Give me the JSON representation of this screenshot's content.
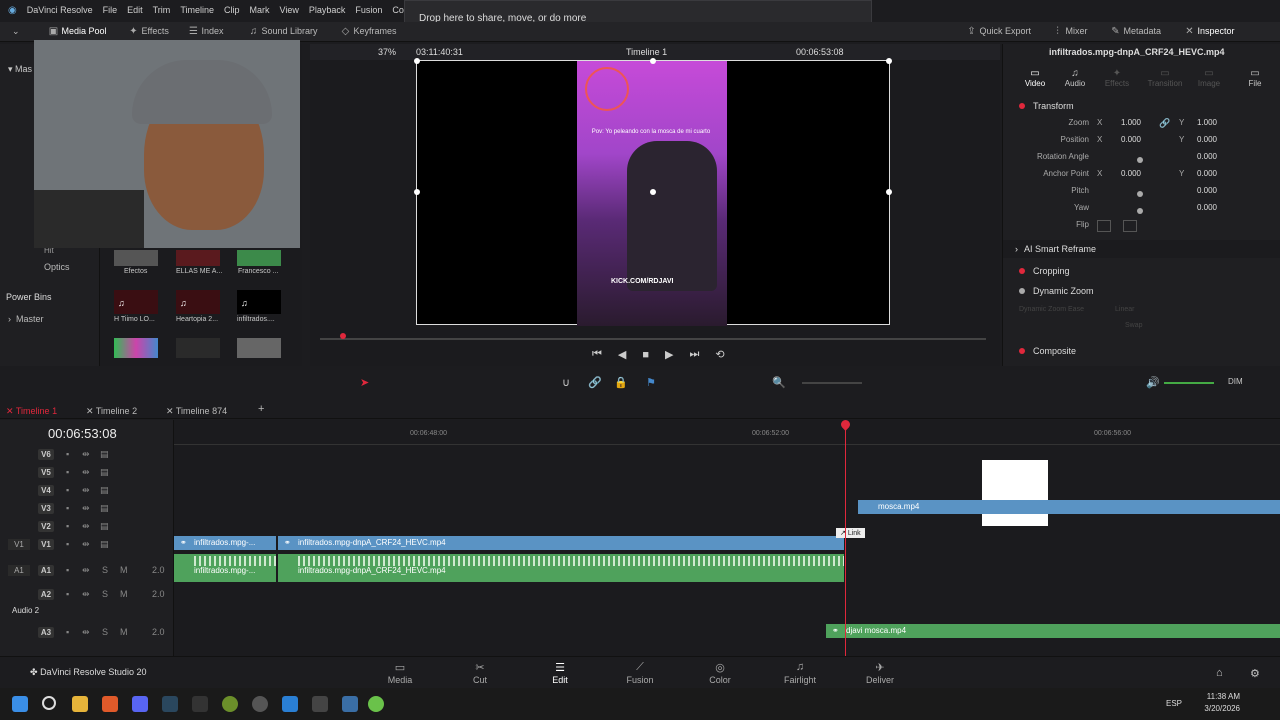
{
  "app": {
    "name": "DaVinci Resolve",
    "product": "DaVinci Resolve Studio 20"
  },
  "menu": [
    "File",
    "Edit",
    "Trim",
    "Timeline",
    "Clip",
    "Mark",
    "View",
    "Playback",
    "Fusion",
    "Color"
  ],
  "banner": "Drop here to share, move, or do more",
  "toolbar": {
    "media_pool": "Media Pool",
    "effects": "Effects",
    "index": "Index",
    "sound_library": "Sound Library",
    "keyframes": "Keyframes",
    "quick_export": "Quick Export",
    "mixer": "Mixer",
    "metadata": "Metadata",
    "inspector": "Inspector"
  },
  "viewer": {
    "zoom": "37%",
    "src_tc": "03:11:40:31",
    "timeline_name": "Timeline 1",
    "rec_tc": "00:06:53:08",
    "overlay_caption": "Pov: Yo peleando con la mosca de mi cuarto",
    "watermark": "KICK.COM/RDJAVI"
  },
  "left": {
    "optics": "Optics",
    "power_bins": "Power Bins",
    "master": "Master",
    "hit": "Hit",
    "mas": "Mas"
  },
  "thumbs": [
    {
      "label": "Efectos"
    },
    {
      "label": "ELLAS ME A..."
    },
    {
      "label": "Francesco ..."
    },
    {
      "label": "H Tiimo LO..."
    },
    {
      "label": "Heartopia 2..."
    },
    {
      "label": "infiltrados...."
    }
  ],
  "inspector": {
    "filename": "infiltrados.mpg-dnpA_CRF24_HEVC.mp4",
    "tabs": [
      "Video",
      "Audio",
      "Effects",
      "Transition",
      "Image",
      "File"
    ],
    "transform": "Transform",
    "zoom": "Zoom",
    "zoom_x": "1.000",
    "zoom_y": "1.000",
    "position": "Position",
    "pos_x": "0.000",
    "pos_y": "0.000",
    "rotation": "Rotation Angle",
    "rotation_val": "0.000",
    "anchor": "Anchor Point",
    "anchor_x": "0.000",
    "anchor_y": "0.000",
    "pitch": "Pitch",
    "pitch_val": "0.000",
    "yaw": "Yaw",
    "yaw_val": "0.000",
    "flip": "Flip",
    "x": "X",
    "y": "Y",
    "ai_reframe": "AI Smart Reframe",
    "cropping": "Cropping",
    "dynamic_zoom": "Dynamic Zoom",
    "dz_ease": "Dynamic Zoom Ease",
    "dz_linear": "Linear",
    "swap": "Swap",
    "composite": "Composite"
  },
  "timeline": {
    "tabs": [
      "Timeline 1",
      "Timeline 2",
      "Timeline 874"
    ],
    "timecode": "00:06:53:08",
    "ruler": [
      "00:06:48:00",
      "00:06:52:00",
      "00:06:56:00"
    ],
    "dim": "DIM",
    "tracks": [
      {
        "name": "V6"
      },
      {
        "name": "V5"
      },
      {
        "name": "V4"
      },
      {
        "name": "V3"
      },
      {
        "name": "V2"
      },
      {
        "name": "V1",
        "src": "V1"
      },
      {
        "name": "A1",
        "src": "A1",
        "vol": "2.0"
      },
      {
        "name": "A2",
        "vol": "2.0"
      },
      {
        "name": "A3",
        "vol": "2.0"
      }
    ],
    "audio2": "Audio 2",
    "clips": {
      "v1a": "infiltrados.mpg-...",
      "v1b": "infiltrados.mpg-dnpA_CRF24_HEVC.mp4",
      "a1a": "infiltrados.mpg-...",
      "a1b": "infiltrados.mpg-dnpA_CRF24_HEVC.mp4",
      "v2": "mosca.mp4",
      "a3": "djavi mosca.mp4"
    },
    "link_tip": "Link"
  },
  "pages": [
    "Media",
    "Cut",
    "Edit",
    "Fusion",
    "Color",
    "Fairlight",
    "Deliver"
  ],
  "taskbar": {
    "lang": "ESP",
    "time": "11:38 AM",
    "date": "3/20/2026"
  }
}
